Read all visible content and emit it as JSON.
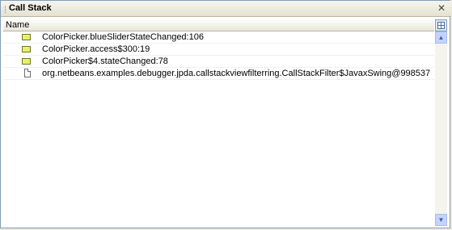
{
  "window": {
    "title": "Call Stack",
    "close_glyph": "✕"
  },
  "table": {
    "column_header": "Name",
    "rows": [
      {
        "icon": "stack-frame-icon",
        "label": "ColorPicker.blueSliderStateChanged:106"
      },
      {
        "icon": "stack-frame-icon",
        "label": "ColorPicker.access$300:19"
      },
      {
        "icon": "stack-frame-icon",
        "label": "ColorPicker$4.stateChanged:78"
      },
      {
        "icon": "hidden-frames-icon",
        "label": "org.netbeans.examples.debugger.jpda.callstackviewfilterring.CallStackFilter$JavaxSwing@998537"
      }
    ]
  },
  "scrollbar": {
    "up_glyph": "▲",
    "down_glyph": "▼"
  },
  "colors": {
    "frame_icon_fill": "#e8f06a",
    "border": "#7f9db9",
    "scroll_button": "#c3d3fd"
  }
}
